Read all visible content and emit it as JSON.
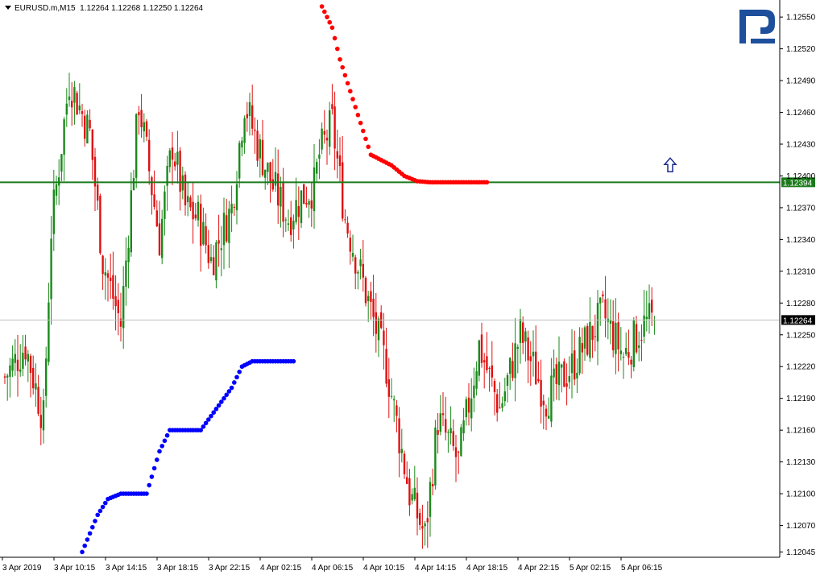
{
  "header": {
    "symbol": "EURUSD.m,M15",
    "ohlc": "1.12264 1.12268 1.12250 1.12264"
  },
  "logo": {
    "name": "broker-logo",
    "color": "#1d4f9c"
  },
  "colors": {
    "bull": "#1a8a1a",
    "bear": "#e01010",
    "sar_up": "#0000ff",
    "sar_down": "#ff0000",
    "level_line": "#1a7a1a",
    "price_line": "#c0c0c0",
    "arrow": "#1c2a8c"
  },
  "chart_data": {
    "type": "candlestick",
    "symbol": "EURUSD.m",
    "timeframe": "M15",
    "last_ohlc": {
      "open": 1.12264,
      "high": 1.12268,
      "low": 1.1225,
      "close": 1.12264
    },
    "ylim": [
      1.1204,
      1.1256
    ],
    "y_ticks": [
      "1.12550",
      "1.12520",
      "1.12490",
      "1.12460",
      "1.12430",
      "1.12400",
      "1.12370",
      "1.12340",
      "1.12310",
      "1.12280",
      "1.12250",
      "1.12220",
      "1.12190",
      "1.12160",
      "1.12130",
      "1.12100",
      "1.12070",
      "1.12045"
    ],
    "x_ticks": [
      "3 Apr 2019",
      "3 Apr 10:15",
      "3 Apr 14:15",
      "3 Apr 18:15",
      "3 Apr 22:15",
      "4 Apr 02:15",
      "4 Apr 06:15",
      "4 Apr 10:15",
      "4 Apr 14:15",
      "4 Apr 18:15",
      "4 Apr 22:15",
      "5 Apr 02:15",
      "5 Apr 06:15"
    ],
    "bar_count": 200,
    "key_closes": [
      [
        0,
        1.1221
      ],
      [
        8,
        1.1224
      ],
      [
        15,
        1.1217
      ],
      [
        18,
        1.1235
      ],
      [
        25,
        1.1249
      ],
      [
        33,
        1.1244
      ],
      [
        38,
        1.1232
      ],
      [
        45,
        1.1226
      ],
      [
        52,
        1.1247
      ],
      [
        60,
        1.1234
      ],
      [
        65,
        1.1243
      ],
      [
        70,
        1.1237
      ],
      [
        75,
        1.1236
      ],
      [
        80,
        1.1232
      ],
      [
        88,
        1.1237
      ],
      [
        93,
        1.1247
      ],
      [
        98,
        1.1243
      ],
      [
        104,
        1.1239
      ],
      [
        110,
        1.1236
      ],
      [
        115,
        1.1238
      ],
      [
        120,
        1.1239
      ],
      [
        122,
        1.1242
      ],
      [
        127,
        1.1245
      ],
      [
        132,
        1.1236
      ],
      [
        140,
        1.1229
      ],
      [
        148,
        1.1222
      ],
      [
        157,
        1.121
      ],
      [
        163,
        1.1206
      ],
      [
        168,
        1.1217
      ],
      [
        176,
        1.1213
      ],
      [
        184,
        1.1224
      ],
      [
        192,
        1.1218
      ],
      [
        200,
        1.1225
      ],
      [
        210,
        1.1219
      ],
      [
        220,
        1.1222
      ],
      [
        232,
        1.1227
      ],
      [
        240,
        1.1223
      ],
      [
        248,
        1.1226
      ],
      [
        252,
        1.12264
      ]
    ],
    "series": [
      {
        "name": "",
        "type": "parabolic-sar-up",
        "points": [
          [
            30,
            1.12045
          ],
          [
            36,
            1.1208
          ],
          [
            40,
            1.12095
          ],
          [
            45,
            1.121
          ],
          [
            50,
            1.121
          ],
          [
            55,
            1.121
          ],
          [
            60,
            1.1214
          ],
          [
            64,
            1.1216
          ],
          [
            68,
            1.1216
          ],
          [
            76,
            1.1216
          ],
          [
            82,
            1.1218
          ],
          [
            88,
            1.122
          ],
          [
            92,
            1.1222
          ],
          [
            96,
            1.12225
          ],
          [
            100,
            1.12225
          ],
          [
            104,
            1.12225
          ],
          [
            110,
            1.12225
          ],
          [
            112,
            1.12225
          ]
        ]
      },
      {
        "name": "",
        "type": "parabolic-sar-down",
        "points": [
          [
            123,
            1.1256
          ],
          [
            127,
            1.1254
          ],
          [
            130,
            1.1251
          ],
          [
            134,
            1.1248
          ],
          [
            138,
            1.1245
          ],
          [
            142,
            1.1242
          ],
          [
            146,
            1.12415
          ],
          [
            150,
            1.1241
          ],
          [
            155,
            1.124
          ],
          [
            160,
            1.12395
          ],
          [
            165,
            1.12394
          ],
          [
            170,
            1.12394
          ],
          [
            175,
            1.12394
          ],
          [
            187,
            1.12394
          ]
        ]
      }
    ],
    "horizontal_lines": [
      {
        "value": 1.12394,
        "label": "1.12394",
        "style": "solid-green"
      },
      {
        "value": 1.12264,
        "label": "1.12264",
        "style": "thin-gray"
      }
    ],
    "annotations": [
      {
        "type": "up-arrow",
        "value": 1.1241
      }
    ],
    "grid": false,
    "legend": "none"
  }
}
